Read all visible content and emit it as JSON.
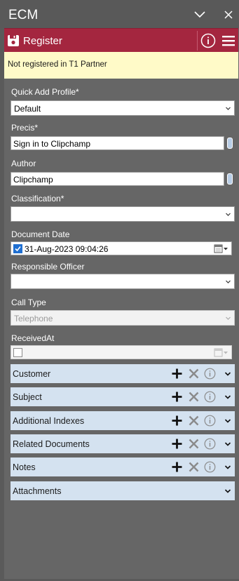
{
  "app": {
    "title": "ECM"
  },
  "register": {
    "label": "Register"
  },
  "banner": {
    "text": "Not registered in T1 Partner"
  },
  "fields": {
    "quick_add_profile": {
      "label": "Quick Add Profile*",
      "value": "Default"
    },
    "precis": {
      "label": "Precis*",
      "value": "Sign in to Clipchamp"
    },
    "author": {
      "label": "Author",
      "value": "Clipchamp"
    },
    "classification": {
      "label": "Classification*",
      "value": ""
    },
    "document_date": {
      "label": "Document Date",
      "value": "31-Aug-2023 09:04:26",
      "checked": true
    },
    "responsible_officer": {
      "label": "Responsible Officer",
      "value": ""
    },
    "call_type": {
      "label": "Call Type",
      "value": "Telephone"
    },
    "received_at": {
      "label": "ReceivedAt",
      "value": "",
      "checked": false
    }
  },
  "sections": [
    {
      "label": "Customer",
      "actions": true
    },
    {
      "label": "Subject",
      "actions": true
    },
    {
      "label": "Additional Indexes",
      "actions": true
    },
    {
      "label": "Related Documents",
      "actions": true
    },
    {
      "label": "Notes",
      "actions": true
    },
    {
      "label": "Attachments",
      "actions": false
    }
  ],
  "colors": {
    "window_bg": "#5a5a5a",
    "register_bar": "#a4263f",
    "banner_bg": "#fffac8",
    "section_bg": "#d4e2f0",
    "checkbox_blue": "#1f6fd1"
  },
  "icons": {
    "minimize": "chevron-down-icon",
    "close": "close-icon",
    "register": "save-icon",
    "info": "info-icon",
    "menu": "hamburger-menu-icon",
    "add": "plus-icon",
    "remove": "x-icon",
    "expand": "chevron-down-icon",
    "calendar": "calendar-icon"
  }
}
